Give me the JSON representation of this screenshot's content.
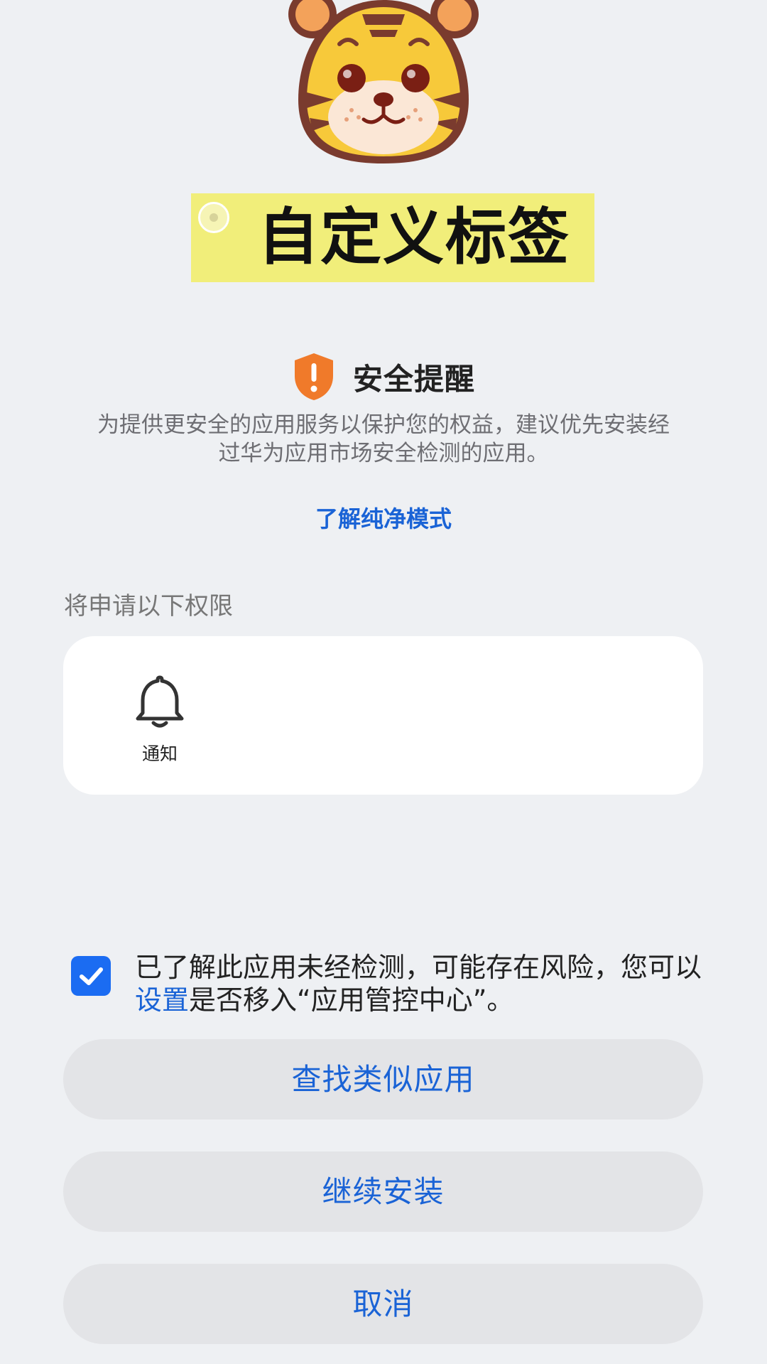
{
  "tag": {
    "title": "自定义标签"
  },
  "security": {
    "title": "安全提醒",
    "description_line1": "为提供更安全的应用服务以保护您的权益，建议优先安装经",
    "description_line2": "过华为应用市场安全检测的应用。",
    "learn_link": "了解纯净模式",
    "icon": "warning-shield-icon",
    "icon_color": "#f07a2a"
  },
  "permissions": {
    "heading": "将申请以下权限",
    "items": [
      {
        "label": "通知",
        "icon": "bell-icon"
      }
    ]
  },
  "consent": {
    "checked": true,
    "text_before": "已了解此应用未经检测，可能存在风险，您可以",
    "link_text": "设置",
    "text_after": "是否移入“应用管控中心”。"
  },
  "buttons": {
    "find_similar": "查找类似应用",
    "continue_install": "继续安装",
    "cancel": "取消"
  },
  "colors": {
    "accent": "#1a63d6",
    "checkbox": "#1b6cf2",
    "background": "#eef0f3",
    "tag_yellow": "#f1ee7a"
  }
}
